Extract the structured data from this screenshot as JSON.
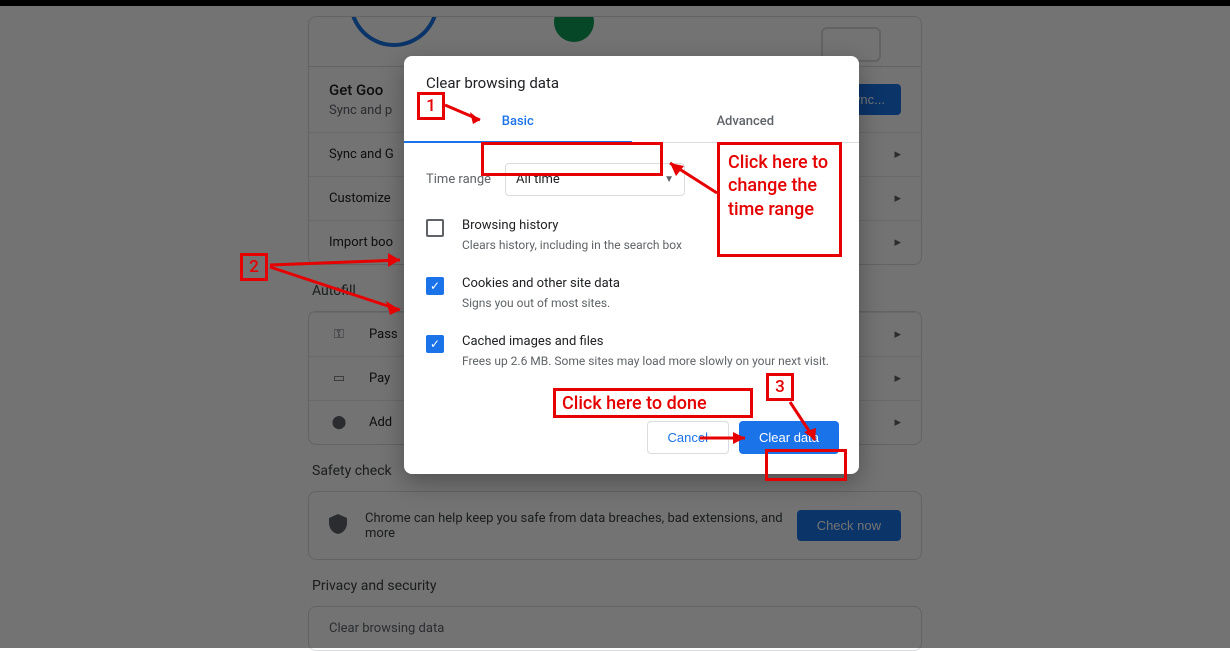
{
  "background": {
    "get_google_title": "Get Goo",
    "get_google_sub": "Sync and p",
    "sync_button": "n sync...",
    "rows": {
      "sync": "Sync and G",
      "customize": "Customize",
      "import": "Import boo"
    },
    "autofill_title": "Autofill",
    "autofill_rows": {
      "pass": "Pass",
      "pay": "Pay",
      "add": "Add"
    },
    "safety_title": "Safety check",
    "safety_text": "Chrome can help keep you safe from data breaches, bad extensions, and more",
    "check_now": "Check now",
    "privacy_title": "Privacy and security",
    "privacy_row": "Clear browsing data"
  },
  "dialog": {
    "title": "Clear browsing data",
    "tabs": {
      "basic": "Basic",
      "advanced": "Advanced"
    },
    "time_label": "Time range",
    "time_value": "All time",
    "options": [
      {
        "title": "Browsing history",
        "desc": "Clears history, including in the search box",
        "checked": false
      },
      {
        "title": "Cookies and other site data",
        "desc": "Signs you out of most sites.",
        "checked": true
      },
      {
        "title": "Cached images and files",
        "desc": "Frees up 2.6 MB. Some sites may load more slowly on your next visit.",
        "checked": true
      }
    ],
    "cancel": "Cancel",
    "clear": "Clear data"
  },
  "annotations": {
    "n1": "1",
    "n2": "2",
    "n3": "3",
    "time_hint": "Click here to change the time range",
    "done_hint": "Click here to done"
  }
}
